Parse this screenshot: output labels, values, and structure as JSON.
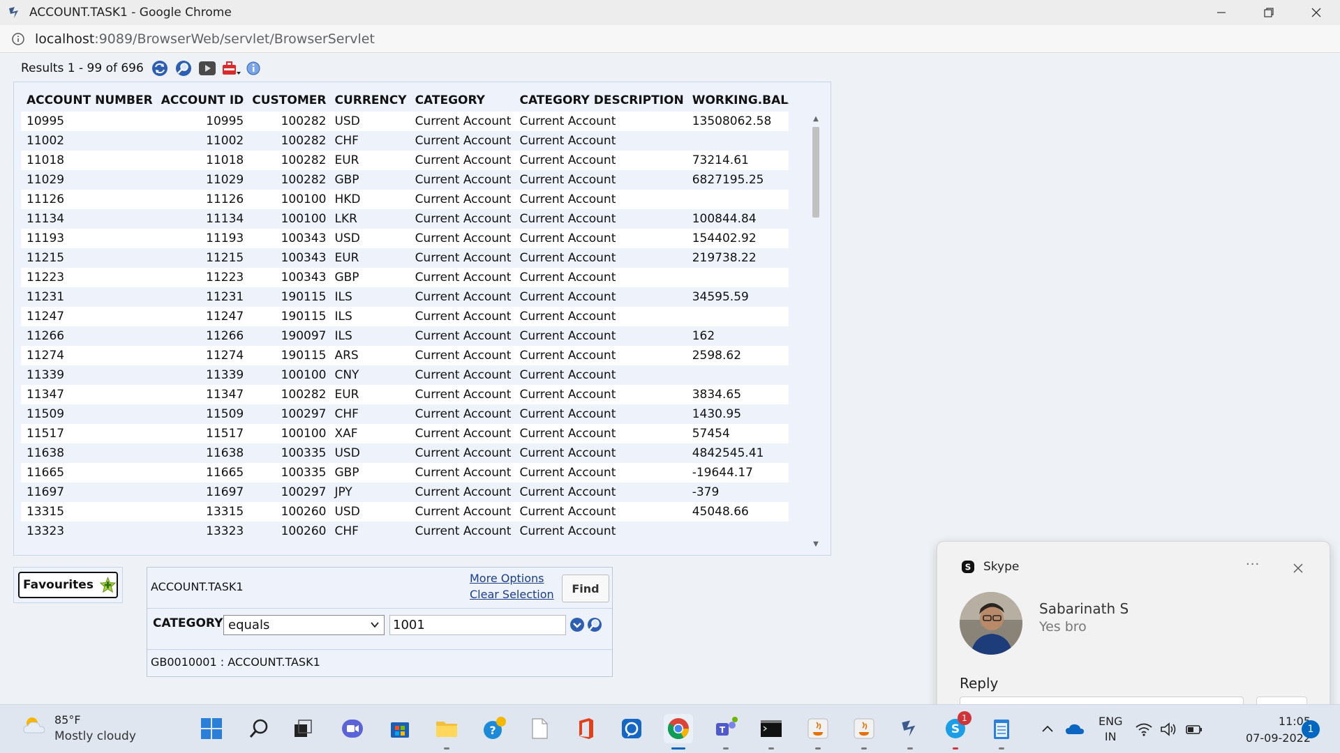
{
  "window": {
    "title": "ACCOUNT.TASK1 - Google Chrome",
    "url_host": "localhost",
    "url_path": ":9089/BrowserWeb/servlet/BrowserServlet"
  },
  "results": {
    "text": "Results 1 - 99 of 696",
    "icons": [
      "refresh-icon",
      "search-icon",
      "next-icon",
      "tools-icon",
      "info-icon"
    ]
  },
  "grid": {
    "columns": [
      "ACCOUNT NUMBER",
      "ACCOUNT ID",
      "CUSTOMER",
      "CURRENCY",
      "CATEGORY",
      "CATEGORY DESCRIPTION",
      "WORKING.BALANCE"
    ],
    "rows": [
      [
        "10995",
        "10995",
        "100282",
        "USD",
        "Current Account",
        "Current Account",
        "13508062.58"
      ],
      [
        "11002",
        "11002",
        "100282",
        "CHF",
        "Current Account",
        "Current Account",
        ""
      ],
      [
        "11018",
        "11018",
        "100282",
        "EUR",
        "Current Account",
        "Current Account",
        "73214.61"
      ],
      [
        "11029",
        "11029",
        "100282",
        "GBP",
        "Current Account",
        "Current Account",
        "6827195.25"
      ],
      [
        "11126",
        "11126",
        "100100",
        "HKD",
        "Current Account",
        "Current Account",
        ""
      ],
      [
        "11134",
        "11134",
        "100100",
        "LKR",
        "Current Account",
        "Current Account",
        "100844.84"
      ],
      [
        "11193",
        "11193",
        "100343",
        "USD",
        "Current Account",
        "Current Account",
        "154402.92"
      ],
      [
        "11215",
        "11215",
        "100343",
        "EUR",
        "Current Account",
        "Current Account",
        "219738.22"
      ],
      [
        "11223",
        "11223",
        "100343",
        "GBP",
        "Current Account",
        "Current Account",
        ""
      ],
      [
        "11231",
        "11231",
        "190115",
        "ILS",
        "Current Account",
        "Current Account",
        "34595.59"
      ],
      [
        "11247",
        "11247",
        "190115",
        "ILS",
        "Current Account",
        "Current Account",
        ""
      ],
      [
        "11266",
        "11266",
        "190097",
        "ILS",
        "Current Account",
        "Current Account",
        "162"
      ],
      [
        "11274",
        "11274",
        "190115",
        "ARS",
        "Current Account",
        "Current Account",
        "2598.62"
      ],
      [
        "11339",
        "11339",
        "100100",
        "CNY",
        "Current Account",
        "Current Account",
        ""
      ],
      [
        "11347",
        "11347",
        "100282",
        "EUR",
        "Current Account",
        "Current Account",
        "3834.65"
      ],
      [
        "11509",
        "11509",
        "100297",
        "CHF",
        "Current Account",
        "Current Account",
        "1430.95"
      ],
      [
        "11517",
        "11517",
        "100100",
        "XAF",
        "Current Account",
        "Current Account",
        "57454"
      ],
      [
        "11638",
        "11638",
        "100335",
        "USD",
        "Current Account",
        "Current Account",
        "4842545.41"
      ],
      [
        "11665",
        "11665",
        "100335",
        "GBP",
        "Current Account",
        "Current Account",
        "-19644.17"
      ],
      [
        "11697",
        "11697",
        "100297",
        "JPY",
        "Current Account",
        "Current Account",
        "-379"
      ],
      [
        "13315",
        "13315",
        "100260",
        "USD",
        "Current Account",
        "Current Account",
        "45048.66"
      ],
      [
        "13323",
        "13323",
        "100260",
        "CHF",
        "Current Account",
        "Current Account",
        ""
      ]
    ]
  },
  "favourites": {
    "label": "Favourites"
  },
  "search": {
    "app_name": "ACCOUNT.TASK1",
    "more_options": "More Options",
    "clear_selection": "Clear Selection",
    "find_label": "Find",
    "field_label": "CATEGORY",
    "operator": "equals",
    "value": "1001",
    "company": "GB0010001 : ACCOUNT.TASK1"
  },
  "toast": {
    "app": "Skype",
    "more": "···",
    "sender": "Sabarinath S",
    "message": "Yes bro",
    "reply_label": "Reply",
    "reply_placeholder": "Reply"
  },
  "taskbar": {
    "temperature": "85°F",
    "condition": "Mostly cloudy",
    "lang_line1": "ENG",
    "lang_line2": "IN",
    "time": "11:05",
    "date": "07-09-2022",
    "notifications": "1",
    "skype_badge": "1",
    "colors": {
      "accent": "#0067c0",
      "badge": "#d13438"
    }
  }
}
